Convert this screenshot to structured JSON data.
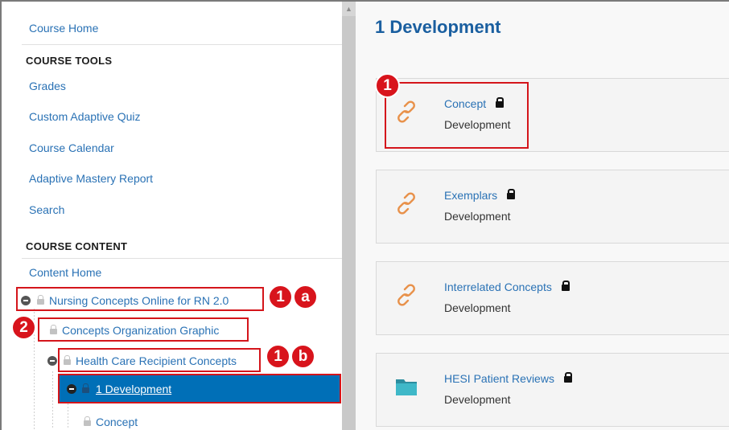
{
  "sidebar": {
    "course_home": "Course Home",
    "tools_heading": "COURSE TOOLS",
    "tools": [
      "Grades",
      "Custom Adaptive Quiz",
      "Course Calendar",
      "Adaptive Mastery Report",
      "Search"
    ],
    "content_heading": "COURSE CONTENT",
    "content_home": "Content Home",
    "tree": {
      "n1": "Nursing Concepts Online for RN 2.0",
      "n2": "Concepts Organization Graphic",
      "n3": "Health Care Recipient Concepts",
      "n4": "1 Development",
      "n5": "Concept"
    }
  },
  "annotations": {
    "a1": "1",
    "a1_letter": "a",
    "a2": "2",
    "a3": "1",
    "a3_letter": "b",
    "a4": "1"
  },
  "main": {
    "title": "1 Development",
    "cards": [
      {
        "title": "Concept",
        "sub": "Development",
        "icon": "link-icon"
      },
      {
        "title": "Exemplars",
        "sub": "Development",
        "icon": "link-icon"
      },
      {
        "title": "Interrelated Concepts",
        "sub": "Development",
        "icon": "link-icon"
      },
      {
        "title": "HESI Patient Reviews",
        "sub": "Development",
        "icon": "folder-icon"
      }
    ]
  },
  "colors": {
    "link": "#2a72b5",
    "title": "#1a5fa0",
    "selected_bg": "#006fb7",
    "annotation_red": "#d8141c",
    "link_icon_orange": "#e8914a",
    "folder_teal": "#3fb8c8"
  }
}
